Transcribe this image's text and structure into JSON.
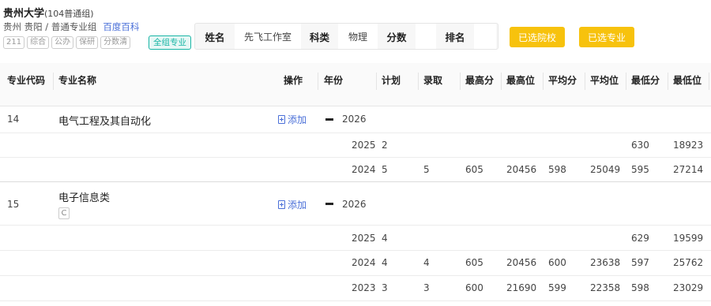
{
  "university": {
    "name": "贵州大学",
    "group": "(104普通组)",
    "location": "贵州 贵阳 / 普通专业组",
    "baike_link": "百度百科",
    "tags": [
      "211",
      "综合",
      "公办",
      "保研",
      "分数清"
    ],
    "all_group_button": "全组专业"
  },
  "infobar": {
    "name_label": "姓名",
    "name_value": "先飞工作室",
    "subject_label": "科类",
    "subject_value": "物理",
    "score_label": "分数",
    "score_value": "",
    "rank_label": "排名",
    "rank_value": ""
  },
  "buttons": {
    "selected_schools": "已选院校",
    "selected_majors": "已选专业"
  },
  "table": {
    "headers": [
      "专业代码",
      "专业名称",
      "操作",
      "年份",
      "计划",
      "录取",
      "最高分",
      "最高位",
      "平均分",
      "平均位",
      "最低分",
      "最低位"
    ],
    "add_label": "添加",
    "majors": [
      {
        "code": "14",
        "name": "电气工程及其自动化",
        "tag": "",
        "current_year": "2026",
        "history": [
          {
            "year": "2025",
            "plan": "2",
            "admit": "",
            "max_score": "",
            "max_rank": "",
            "avg_score": "",
            "avg_rank": "",
            "min_score": "630",
            "min_rank": "18923"
          },
          {
            "year": "2024",
            "plan": "5",
            "admit": "5",
            "max_score": "605",
            "max_rank": "20456",
            "avg_score": "598",
            "avg_rank": "25049",
            "min_score": "595",
            "min_rank": "27214"
          }
        ]
      },
      {
        "code": "15",
        "name": "电子信息类",
        "tag": "C",
        "current_year": "2026",
        "history": [
          {
            "year": "2025",
            "plan": "4",
            "admit": "",
            "max_score": "",
            "max_rank": "",
            "avg_score": "",
            "avg_rank": "",
            "min_score": "629",
            "min_rank": "19599"
          },
          {
            "year": "2024",
            "plan": "4",
            "admit": "4",
            "max_score": "605",
            "max_rank": "20456",
            "avg_score": "600",
            "avg_rank": "23638",
            "min_score": "597",
            "min_rank": "25762"
          },
          {
            "year": "2023",
            "plan": "3",
            "admit": "3",
            "max_score": "600",
            "max_rank": "21690",
            "avg_score": "599",
            "avg_rank": "22358",
            "min_score": "598",
            "min_rank": "23029"
          }
        ]
      }
    ]
  }
}
